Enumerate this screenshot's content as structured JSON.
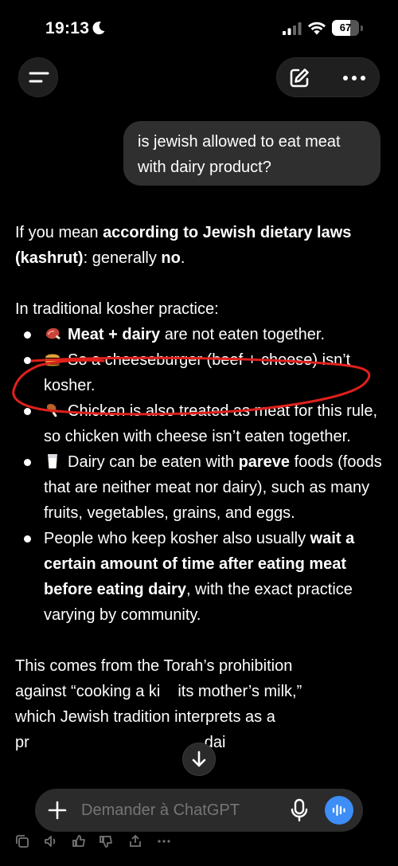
{
  "status": {
    "time": "19:13",
    "battery": "67",
    "battery_level": 0.67,
    "moon_icon": "moon-icon",
    "signal_icon": "cellular-signal-icon",
    "wifi_icon": "wifi-icon"
  },
  "header": {
    "menu_icon": "hamburger-menu-icon",
    "compose_icon": "compose-icon",
    "more_icon": "more-dots-icon"
  },
  "conversation": {
    "user_message": "is jewish allowed to eat meat with dairy product?",
    "assistant": {
      "intro_pre": "If you mean ",
      "intro_bold": "according to Jewish dietary laws (kashrut)",
      "intro_mid": ": generally ",
      "intro_bold2": "no",
      "intro_end": ".",
      "practice_heading": "In traditional kosher practice:",
      "bullets": [
        {
          "emoji": "meat-emoji",
          "bold": "Meat + dairy",
          "text": " are not eaten together."
        },
        {
          "emoji": "cheeseburger-emoji",
          "text": "So a cheeseburger (beef + cheese) isn’t kosher."
        },
        {
          "emoji": "chicken-leg-emoji",
          "text": "Chicken is also treated as meat for this rule, so chicken with cheese isn’t eaten together."
        },
        {
          "emoji": "milk-glass-emoji",
          "pre": "Dairy can be eaten with ",
          "bold": "pareve",
          "text": " foods (foods that are neither meat nor dairy), such as many fruits, vegetables, grains, and eggs."
        },
        {
          "pre": "People who keep kosher also usually ",
          "bold": "wait a certain amount of time after eating meat before eating dairy",
          "text": ", with the exact practice varying by community."
        }
      ],
      "closing_line1": "This comes from the Torah’s prohibition",
      "closing_line2": "against “cooking a ki",
      "closing_line2b": "its mother’s milk,”",
      "closing_line3": "which Jewish tradition interprets as a",
      "closing_line4": "pr",
      "closing_line4b": "dai"
    },
    "annotation_color": "#e0201c"
  },
  "composer": {
    "placeholder": "Demander à ChatGPT",
    "plus_icon": "plus-icon",
    "mic_icon": "microphone-icon",
    "voice_icon": "voice-mode-icon",
    "voice_color": "#3d8ef7"
  },
  "scroll_button_icon": "arrow-down-icon",
  "message_actions": [
    "copy-icon",
    "speaker-icon",
    "thumbs-up-icon",
    "thumbs-down-icon",
    "share-icon",
    "more-icon"
  ]
}
